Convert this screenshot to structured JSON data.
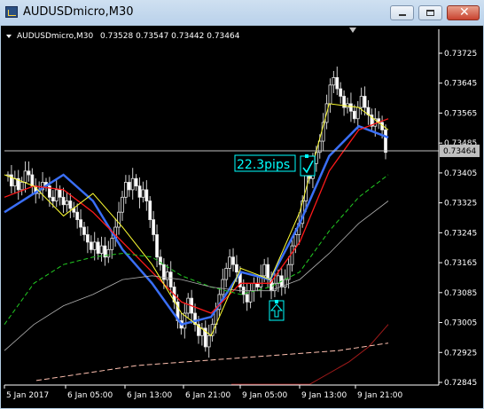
{
  "window": {
    "title": "AUDUSDmicro,M30",
    "app_icon": "metatrader-chart-icon"
  },
  "controls": {
    "minimize": "minimize-icon",
    "maximize": "maximize-icon",
    "close": "close-icon",
    "close_glyph": "✕"
  },
  "header": {
    "symbol_label": "AUDUSDmicro,M30",
    "ohlc": "0.73528 0.73547 0.73442 0.73464"
  },
  "current_price": "0.73464",
  "annotation": {
    "text": "22.3pips",
    "check_icon": "check-mark-icon",
    "arrow_icon": "up-arrow-icon"
  },
  "colors": {
    "background": "#000000",
    "axis": "#ffffff",
    "price_line": "#c0c0c0",
    "bid_label_bg": "#c0c0c0",
    "annotation": "#00ffff",
    "ma_blue": "#3a6ff7",
    "ma_red": "#ff1a1a",
    "ma_yellow": "#ffff33",
    "ma_green": "#22cc22",
    "ma_gray": "#b0b0b0",
    "ma_darkred": "#a01a1a",
    "ma_pink": "#ffc0b0"
  },
  "chart_data": {
    "type": "candlestick",
    "symbol": "AUDUSDmicro",
    "timeframe": "M30",
    "y_ticks": [
      "0.73725",
      "0.73645",
      "0.73565",
      "0.73485",
      "0.73405",
      "0.73325",
      "0.73245",
      "0.73165",
      "0.73085",
      "0.73005",
      "0.72925",
      "0.72845"
    ],
    "x_ticks": [
      "5 Jan 2017",
      "6 Jan 05:00",
      "6 Jan 13:00",
      "6 Jan 21:00",
      "9 Jan 05:00",
      "9 Jan 13:00",
      "9 Jan 21:00"
    ],
    "ylim": [
      0.7284,
      0.7376
    ],
    "last_price": 0.73464,
    "ohlc_last": {
      "open": 0.73528,
      "high": 0.73547,
      "low": 0.73442,
      "close": 0.73464
    },
    "close_series": [
      0.734,
      0.7337,
      0.7339,
      0.7336,
      0.7338,
      0.7341,
      0.734,
      0.7337,
      0.7335,
      0.7336,
      0.7338,
      0.7337,
      0.7334,
      0.7333,
      0.7336,
      0.7334,
      0.7332,
      0.7333,
      0.7331,
      0.733,
      0.7328,
      0.7326,
      0.7324,
      0.7322,
      0.732,
      0.7322,
      0.7319,
      0.7321,
      0.7318,
      0.732,
      0.7323,
      0.7326,
      0.733,
      0.7334,
      0.7338,
      0.7336,
      0.7339,
      0.7337,
      0.7334,
      0.7336,
      0.7333,
      0.7328,
      0.7324,
      0.7318,
      0.7316,
      0.7312,
      0.7314,
      0.731,
      0.7306,
      0.7301,
      0.7299,
      0.7303,
      0.7307,
      0.7303,
      0.73,
      0.7297,
      0.7299,
      0.7294,
      0.7297,
      0.73,
      0.7304,
      0.7308,
      0.7312,
      0.7315,
      0.7318,
      0.7316,
      0.7314,
      0.731,
      0.7308,
      0.7306,
      0.7309,
      0.7311,
      0.731,
      0.7313,
      0.7316,
      0.7312,
      0.7309,
      0.7311,
      0.7313,
      0.731,
      0.7312,
      0.7316,
      0.7321,
      0.7324,
      0.7327,
      0.7333,
      0.734,
      0.7339,
      0.7343,
      0.7346,
      0.7349,
      0.7354,
      0.7359,
      0.7364,
      0.7366,
      0.7363,
      0.7361,
      0.7358,
      0.7359,
      0.7357,
      0.7355,
      0.7358,
      0.7361,
      0.7358,
      0.7356,
      0.7353,
      0.7355,
      0.7354,
      0.7352,
      0.7346
    ],
    "series": [
      {
        "style": "blue",
        "values": [
          0.733,
          0.7335,
          0.734,
          0.7333,
          0.732,
          0.7311,
          0.73,
          0.7302,
          0.7314,
          0.7312,
          0.7327,
          0.7345,
          0.7353,
          0.735
        ]
      },
      {
        "style": "red",
        "values": [
          0.7334,
          0.7337,
          0.7336,
          0.733,
          0.7322,
          0.7314,
          0.7306,
          0.7303,
          0.7311,
          0.7311,
          0.7322,
          0.7341,
          0.7352,
          0.7355
        ]
      },
      {
        "style": "green",
        "values": [
          0.73,
          0.7311,
          0.7316,
          0.7318,
          0.7319,
          0.7318,
          0.7313,
          0.731,
          0.7308,
          0.731,
          0.7314,
          0.7325,
          0.7334,
          0.734
        ]
      },
      {
        "style": "gray",
        "values": [
          0.7293,
          0.73,
          0.7305,
          0.7308,
          0.7312,
          0.7313,
          0.7312,
          0.731,
          0.7309,
          0.7309,
          0.7312,
          0.7319,
          0.7327,
          0.7333
        ]
      },
      {
        "style": "yellow",
        "values": [
          0.734,
          0.7337,
          0.7329,
          0.7335,
          0.7326,
          0.7316,
          0.7303,
          0.7297,
          0.7315,
          0.7312,
          0.733,
          0.7359,
          0.7358,
          0.7352
        ]
      },
      {
        "style": "darkred",
        "values": [
          0.7284,
          0.7284,
          0.7284,
          0.7284,
          0.7284,
          0.7287,
          0.729,
          0.7294,
          0.73
        ]
      },
      {
        "style": "pink",
        "values": [
          0.7285,
          0.7287,
          0.7289,
          0.729,
          0.7291,
          0.7292,
          0.7293,
          0.7295
        ]
      }
    ],
    "annotation": {
      "label": "22.3pips"
    }
  }
}
